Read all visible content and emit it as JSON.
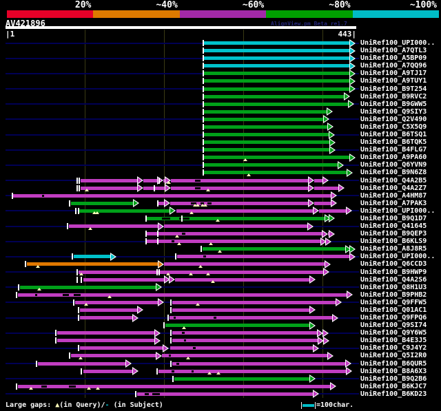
{
  "header": {
    "scale_labels": [
      "20%",
      "~40%",
      "~60%",
      "~80%",
      "~100%"
    ],
    "scale_colors": [
      "#e60028",
      "#dd7a00",
      "#a329a8",
      "#00a000",
      "#00bcc6"
    ],
    "query_id": "AV421896",
    "watermark": "AlignView.pm Beta re1.7"
  },
  "ruler": {
    "left_label": "|1",
    "right_label": "443|"
  },
  "footer": {
    "large_gaps_prefix": "Large gaps: ",
    "gap_query_symbol": "▲",
    "gap_query_text": "(in Query)/",
    "gap_subject_symbol": "-",
    "gap_subject_text": " (in Subject)",
    "scalebar_text": "=100char."
  },
  "colors": {
    "cyan": "#00c2cb",
    "green": "#00a019",
    "magenta": "#c13dc1",
    "orange": "#e07800",
    "track": "#000054",
    "grid": "#3a3a14",
    "gap_marker": "#ffffbb"
  },
  "chart_data": {
    "type": "alignment-map",
    "query_id": "AV421896",
    "query_length": 443,
    "xlim": [
      1,
      443
    ],
    "grid_positions": [
      101,
      201,
      301,
      401
    ],
    "identity_legend": [
      {
        "label": "20%",
        "color": "#e60028"
      },
      {
        "label": "~40%",
        "color": "#dd7a00"
      },
      {
        "label": "~60%",
        "color": "#a329a8"
      },
      {
        "label": "~80%",
        "color": "#00a000"
      },
      {
        "label": "~100%",
        "color": "#00bcc6"
      }
    ],
    "rows": [
      {
        "label": "UniRef100_UPI000..",
        "track": true,
        "ticks": [
          252
        ],
        "segs": [
          {
            "c": "cyan",
            "s": 252,
            "e": 443
          }
        ]
      },
      {
        "label": "UniRef100_A7QTL3",
        "track": false,
        "ticks": [
          252
        ],
        "segs": [
          {
            "c": "cyan",
            "s": 252,
            "e": 443
          }
        ]
      },
      {
        "label": "UniRef100_A5BP09",
        "track": true,
        "ticks": [
          252
        ],
        "segs": [
          {
            "c": "cyan",
            "s": 252,
            "e": 443
          }
        ]
      },
      {
        "label": "UniRef100_A7QQ96",
        "track": false,
        "ticks": [
          252
        ],
        "segs": [
          {
            "c": "cyan",
            "s": 252,
            "e": 443
          }
        ]
      },
      {
        "label": "UniRef100_A9TJ17",
        "track": true,
        "ticks": [
          252
        ],
        "segs": [
          {
            "c": "green",
            "s": 252,
            "e": 443
          }
        ]
      },
      {
        "label": "UniRef100_A9TUY1",
        "track": false,
        "ticks": [
          252
        ],
        "segs": [
          {
            "c": "green",
            "s": 252,
            "e": 443
          }
        ]
      },
      {
        "label": "UniRef100_B9T254",
        "track": true,
        "ticks": [
          252
        ],
        "segs": [
          {
            "c": "green",
            "s": 252,
            "e": 443
          }
        ]
      },
      {
        "label": "UniRef100_B9RVC2",
        "track": false,
        "ticks": [
          252
        ],
        "segs": [
          {
            "c": "green",
            "s": 252,
            "e": 436
          }
        ]
      },
      {
        "label": "UniRef100_B9GWW5",
        "track": true,
        "ticks": [
          252
        ],
        "segs": [
          {
            "c": "green",
            "s": 252,
            "e": 441
          }
        ]
      },
      {
        "label": "UniRef100_Q9SIY3",
        "track": false,
        "ticks": [
          252
        ],
        "segs": [
          {
            "c": "green",
            "s": 252,
            "e": 414
          }
        ]
      },
      {
        "label": "UniRef100_Q2V490",
        "track": true,
        "ticks": [
          252
        ],
        "segs": [
          {
            "c": "green",
            "s": 252,
            "e": 410
          }
        ]
      },
      {
        "label": "UniRef100_C5X5Q9",
        "track": false,
        "ticks": [
          252
        ],
        "segs": [
          {
            "c": "green",
            "s": 252,
            "e": 415
          }
        ]
      },
      {
        "label": "UniRef100_B6TSQ1",
        "track": true,
        "ticks": [
          252
        ],
        "segs": [
          {
            "c": "green",
            "s": 252,
            "e": 417
          }
        ]
      },
      {
        "label": "UniRef100_B6TQK5",
        "track": false,
        "ticks": [
          252
        ],
        "segs": [
          {
            "c": "green",
            "s": 252,
            "e": 418
          }
        ]
      },
      {
        "label": "UniRef100_B4FLG7",
        "track": true,
        "ticks": [
          252
        ],
        "segs": [
          {
            "c": "green",
            "s": 252,
            "e": 418
          }
        ]
      },
      {
        "label": "UniRef100_A9PA60",
        "track": false,
        "ticks": [
          252
        ],
        "segs": [
          {
            "c": "green",
            "s": 252,
            "e": 443
          }
        ],
        "gq": [
          304
        ]
      },
      {
        "label": "UniRef100_Q6YVN9",
        "track": true,
        "ticks": [
          252
        ],
        "segs": [
          {
            "c": "green",
            "s": 252,
            "e": 428
          }
        ]
      },
      {
        "label": "UniRef100_B9N6Z8",
        "track": false,
        "ticks": [
          252
        ],
        "segs": [
          {
            "c": "green",
            "s": 252,
            "e": 440
          }
        ],
        "gq": [
          308
        ]
      },
      {
        "label": "UniRef100_Q4A2B5",
        "track": true,
        "ticks": [
          92,
          95,
          196
        ],
        "segs": [
          {
            "c": "magenta",
            "s": 96,
            "e": 175
          },
          {
            "c": "magenta",
            "s": 175,
            "e": 200
          },
          {
            "c": "magenta",
            "s": 200,
            "e": 210
          },
          {
            "c": "magenta",
            "s": 210,
            "e": 391
          },
          {
            "c": "magenta",
            "s": 391,
            "e": 409
          }
        ],
        "gs": [
          [
            240,
            247
          ]
        ],
        "gq": [
          207
        ]
      },
      {
        "label": "UniRef100_Q4A2Z7",
        "track": false,
        "ticks": [
          92,
          95,
          190
        ],
        "segs": [
          {
            "c": "magenta",
            "s": 96,
            "e": 175
          },
          {
            "c": "magenta",
            "s": 175,
            "e": 210
          },
          {
            "c": "magenta",
            "s": 210,
            "e": 391
          },
          {
            "c": "magenta",
            "s": 391,
            "e": 429
          }
        ],
        "gs": [
          [
            240,
            247
          ]
        ],
        "gq": [
          104,
          257
        ]
      },
      {
        "label": "UniRef100_A4HM87",
        "track": true,
        "ticks": [
          11
        ],
        "segs": [
          {
            "c": "magenta",
            "s": 11,
            "e": 420
          }
        ],
        "gs": [
          [
            47,
            50
          ]
        ]
      },
      {
        "label": "UniRef100_A7PAK3",
        "track": false,
        "ticks": [
          83,
          194
        ],
        "segs": [
          {
            "c": "green",
            "s": 84,
            "e": 170
          },
          {
            "c": "magenta",
            "s": 194,
            "e": 209
          },
          {
            "c": "magenta",
            "s": 209,
            "e": 391
          },
          {
            "c": "magenta",
            "s": 391,
            "e": 420
          }
        ],
        "gs": [
          [
            235,
            242
          ],
          [
            247,
            252
          ],
          [
            256,
            261
          ]
        ],
        "gq": [
          240,
          244,
          250,
          253
        ]
      },
      {
        "label": "UniRef100_UPI000..",
        "track": true,
        "ticks": [
          91,
          94
        ],
        "segs": [
          {
            "c": "green",
            "s": 94,
            "e": 216
          },
          {
            "c": "magenta",
            "s": 217,
            "e": 397
          },
          {
            "c": "magenta",
            "s": 397,
            "e": 439
          }
        ],
        "gq": [
          113,
          117,
          236
        ]
      },
      {
        "label": "UniRef100_B9Q1D7",
        "track": false,
        "ticks": [
          179,
          225
        ],
        "segs": [
          {
            "c": "green",
            "s": 179,
            "e": 412
          },
          {
            "c": "green",
            "s": 412,
            "e": 417
          }
        ],
        "gs": [
          [
            199,
            209
          ],
          [
            220,
            233
          ]
        ],
        "gq": [
          269
        ]
      },
      {
        "label": "UniRef100_Q41645",
        "track": true,
        "ticks": [
          80
        ],
        "segs": [
          {
            "c": "magenta",
            "s": 81,
            "e": 201
          },
          {
            "c": "magenta",
            "s": 201,
            "e": 390
          }
        ],
        "gq": [
          108
        ]
      },
      {
        "label": "UniRef100_B9QEP3",
        "track": false,
        "ticks": [
          179,
          194
        ],
        "segs": [
          {
            "c": "magenta",
            "s": 179,
            "e": 408
          },
          {
            "c": "magenta",
            "s": 408,
            "e": 417
          }
        ],
        "gs": [
          [
            224,
            228
          ]
        ],
        "gq": [
          218
        ]
      },
      {
        "label": "UniRef100_B6KLS9",
        "track": true,
        "ticks": [
          179,
          194
        ],
        "segs": [
          {
            "c": "magenta",
            "s": 179,
            "e": 407
          },
          {
            "c": "magenta",
            "s": 407,
            "e": 413
          }
        ],
        "gs": [
          [
            211,
            214
          ]
        ],
        "gq": [
          220,
          260
        ]
      },
      {
        "label": "UniRef100_A8J8R5",
        "track": false,
        "ticks": [
          249
        ],
        "segs": [
          {
            "c": "green",
            "s": 250,
            "e": 438
          },
          {
            "c": "green",
            "s": 438,
            "e": 443
          }
        ],
        "gq": [
          272
        ]
      },
      {
        "label": "UniRef100_UPI000..",
        "track": true,
        "ticks": [
          86,
          217
        ],
        "segs": [
          {
            "c": "cyan",
            "s": 87,
            "e": 141
          },
          {
            "c": "magenta",
            "s": 218,
            "e": 443
          }
        ],
        "gs": [
          [
            251,
            254
          ]
        ]
      },
      {
        "label": "UniRef100_Q6CCD3",
        "track": false,
        "ticks": [
          27
        ],
        "segs": [
          {
            "c": "orange",
            "s": 28,
            "e": 201
          },
          {
            "c": "magenta",
            "s": 201,
            "e": 412
          }
        ],
        "gq": [
          42,
          247
        ]
      },
      {
        "label": "UniRef100_B9HWP9",
        "track": true,
        "ticks": [
          92,
          193,
          196
        ],
        "segs": [
          {
            "c": "magenta",
            "s": 93,
            "e": 410
          }
        ],
        "gq": [
          97,
          206,
          235,
          257
        ]
      },
      {
        "label": "UniRef100_Q4A2S6",
        "track": false,
        "ticks": [
          92,
          98
        ],
        "segs": [
          {
            "c": "magenta",
            "s": 99,
            "e": 209
          },
          {
            "c": "magenta",
            "s": 209,
            "e": 215
          },
          {
            "c": "magenta",
            "s": 215,
            "e": 393
          }
        ],
        "gq": [
          263
        ]
      },
      {
        "label": "UniRef100_Q8H1U3",
        "track": true,
        "ticks": [
          18
        ],
        "segs": [
          {
            "c": "green",
            "s": 19,
            "e": 199
          }
        ],
        "gq": [
          44
        ]
      },
      {
        "label": "UniRef100_B9PHB2",
        "track": false,
        "ticks": [
          16
        ],
        "segs": [
          {
            "c": "magenta",
            "s": 17,
            "e": 440
          }
        ],
        "gs": [
          [
            38,
            41
          ],
          [
            73,
            81
          ],
          [
            87,
            96
          ]
        ],
        "gq": [
          132
        ]
      },
      {
        "label": "UniRef100_Q9FFW5",
        "track": true,
        "ticks": [
          88,
          211
        ],
        "segs": [
          {
            "c": "magenta",
            "s": 89,
            "e": 201
          },
          {
            "c": "magenta",
            "s": 212,
            "e": 426
          }
        ],
        "gq": [
          103,
          244
        ]
      },
      {
        "label": "UniRef100_Q01AC1",
        "track": false,
        "ticks": [
          94,
          211
        ],
        "segs": [
          {
            "c": "magenta",
            "s": 95,
            "e": 175
          },
          {
            "c": "magenta",
            "s": 212,
            "e": 393
          }
        ]
      },
      {
        "label": "UniRef100_Q9FPQ6",
        "track": true,
        "ticks": [
          94,
          207
        ],
        "segs": [
          {
            "c": "magenta",
            "s": 95,
            "e": 169
          },
          {
            "c": "magenta",
            "s": 208,
            "e": 421
          }
        ],
        "gs": [
          [
            213,
            216
          ],
          [
            264,
            267
          ]
        ]
      },
      {
        "label": "UniRef100_Q9SI74",
        "track": false,
        "ticks": [
          202
        ],
        "segs": [
          {
            "c": "green",
            "s": 203,
            "e": 393
          }
        ],
        "gq": [
          226
        ]
      },
      {
        "label": "UniRef100_Q9Y6W5",
        "track": true,
        "ticks": [
          65,
          211
        ],
        "segs": [
          {
            "c": "magenta",
            "s": 66,
            "e": 197
          },
          {
            "c": "magenta",
            "s": 212,
            "e": 402
          },
          {
            "c": "magenta",
            "s": 402,
            "e": 409
          }
        ],
        "gs": [
          [
            224,
            227
          ]
        ]
      },
      {
        "label": "UniRef100_B4E3J5",
        "track": false,
        "ticks": [
          65,
          211
        ],
        "segs": [
          {
            "c": "magenta",
            "s": 66,
            "e": 197
          },
          {
            "c": "magenta",
            "s": 212,
            "e": 403
          },
          {
            "c": "magenta",
            "s": 403,
            "e": 410
          }
        ],
        "gs": [
          [
            226,
            229
          ]
        ]
      },
      {
        "label": "UniRef100_C9J4Y2",
        "track": true,
        "ticks": [
          94
        ],
        "segs": [
          {
            "c": "magenta",
            "s": 95,
            "e": 207
          },
          {
            "c": "magenta",
            "s": 209,
            "e": 397
          }
        ],
        "gs": [
          [
            238,
            241
          ]
        ]
      },
      {
        "label": "UniRef100_Q5I2R0",
        "track": false,
        "ticks": [
          83
        ],
        "segs": [
          {
            "c": "magenta",
            "s": 84,
            "e": 199
          },
          {
            "c": "magenta",
            "s": 199,
            "e": 415
          }
        ],
        "gs": [
          [
            207,
            210
          ]
        ],
        "gq": [
          96,
          232
        ]
      },
      {
        "label": "UniRef100_B6QUR5",
        "track": true,
        "ticks": [
          41,
          211
        ],
        "segs": [
          {
            "c": "magenta",
            "s": 42,
            "e": 160
          },
          {
            "c": "magenta",
            "s": 212,
            "e": 438
          }
        ],
        "gs": [
          [
            217,
            220
          ]
        ]
      },
      {
        "label": "UniRef100_B8A6X3",
        "track": false,
        "ticks": [
          98,
          193
        ],
        "segs": [
          {
            "c": "magenta",
            "s": 99,
            "e": 169
          },
          {
            "c": "magenta",
            "s": 194,
            "e": 439
          }
        ],
        "gs": [
          [
            211,
            214
          ],
          [
            236,
            239
          ]
        ],
        "gq": [
          259,
          270
        ]
      },
      {
        "label": "UniRef100_B9Q2B6",
        "track": true,
        "ticks": [
          213
        ],
        "segs": [
          {
            "c": "green",
            "s": 214,
            "e": 393
          }
        ]
      },
      {
        "label": "UniRef100_B6KJC7",
        "track": false,
        "ticks": [
          16
        ],
        "segs": [
          {
            "c": "magenta",
            "s": 17,
            "e": 419
          }
        ],
        "gs": [
          [
            46,
            53
          ],
          [
            81,
            90
          ]
        ],
        "gq": [
          33,
          106,
          118
        ]
      },
      {
        "label": "UniRef100_B6KD23",
        "track": true,
        "ticks": [
          166
        ],
        "segs": [
          {
            "c": "magenta",
            "s": 167,
            "e": 397
          }
        ],
        "gs": [
          [
            177,
            182
          ],
          [
            186,
            196
          ]
        ]
      }
    ]
  }
}
